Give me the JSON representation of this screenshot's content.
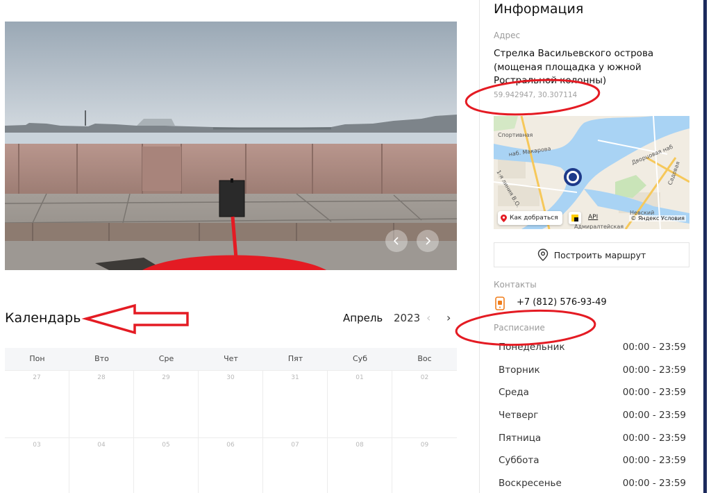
{
  "photo": {
    "prev_icon": "chevron-left-icon",
    "next_icon": "chevron-right-icon"
  },
  "calendar": {
    "title": "Календарь",
    "month": "Апрель",
    "year": "2023",
    "prev_icon": "‹",
    "next_icon": "›",
    "weekdays": [
      "Пон",
      "Вто",
      "Сре",
      "Чет",
      "Пят",
      "Суб",
      "Вос"
    ],
    "weeks": [
      [
        "27",
        "28",
        "29",
        "30",
        "31",
        "01",
        "02"
      ],
      [
        "03",
        "04",
        "05",
        "06",
        "07",
        "08",
        "09"
      ]
    ]
  },
  "info": {
    "title": "Информация",
    "address_label": "Адрес",
    "address": "Стрелка Васильевского острова (мощеная площадка у южной Ростральной колонны)",
    "coords": "59.942947, 30.307114",
    "map": {
      "howto": "Как добраться",
      "api": "API",
      "copyright": "© Яндекс Условия",
      "labels": [
        "Спортивная",
        "наб. Макарова",
        "Дворцовая наб",
        "1-я линия В.О.",
        "Невский",
        "Садовая",
        "Адмиралтейская"
      ]
    },
    "route_button": "Построить маршрут",
    "contacts_label": "Контакты",
    "phone": "+7 (812) 576-93-49",
    "schedule_label": "Расписание",
    "schedule": [
      {
        "day": "Понедельник",
        "time": "00:00 - 23:59"
      },
      {
        "day": "Вторник",
        "time": "00:00 - 23:59"
      },
      {
        "day": "Среда",
        "time": "00:00 - 23:59"
      },
      {
        "day": "Четверг",
        "time": "00:00 - 23:59"
      },
      {
        "day": "Пятница",
        "time": "00:00 - 23:59"
      },
      {
        "day": "Суббота",
        "time": "00:00 - 23:59"
      },
      {
        "day": "Воскресенье",
        "time": "00:00 - 23:59"
      }
    ]
  },
  "colors": {
    "accent": "#1c2a5c",
    "annotation": "#e41b23",
    "phone_icon": "#f07d1a"
  }
}
